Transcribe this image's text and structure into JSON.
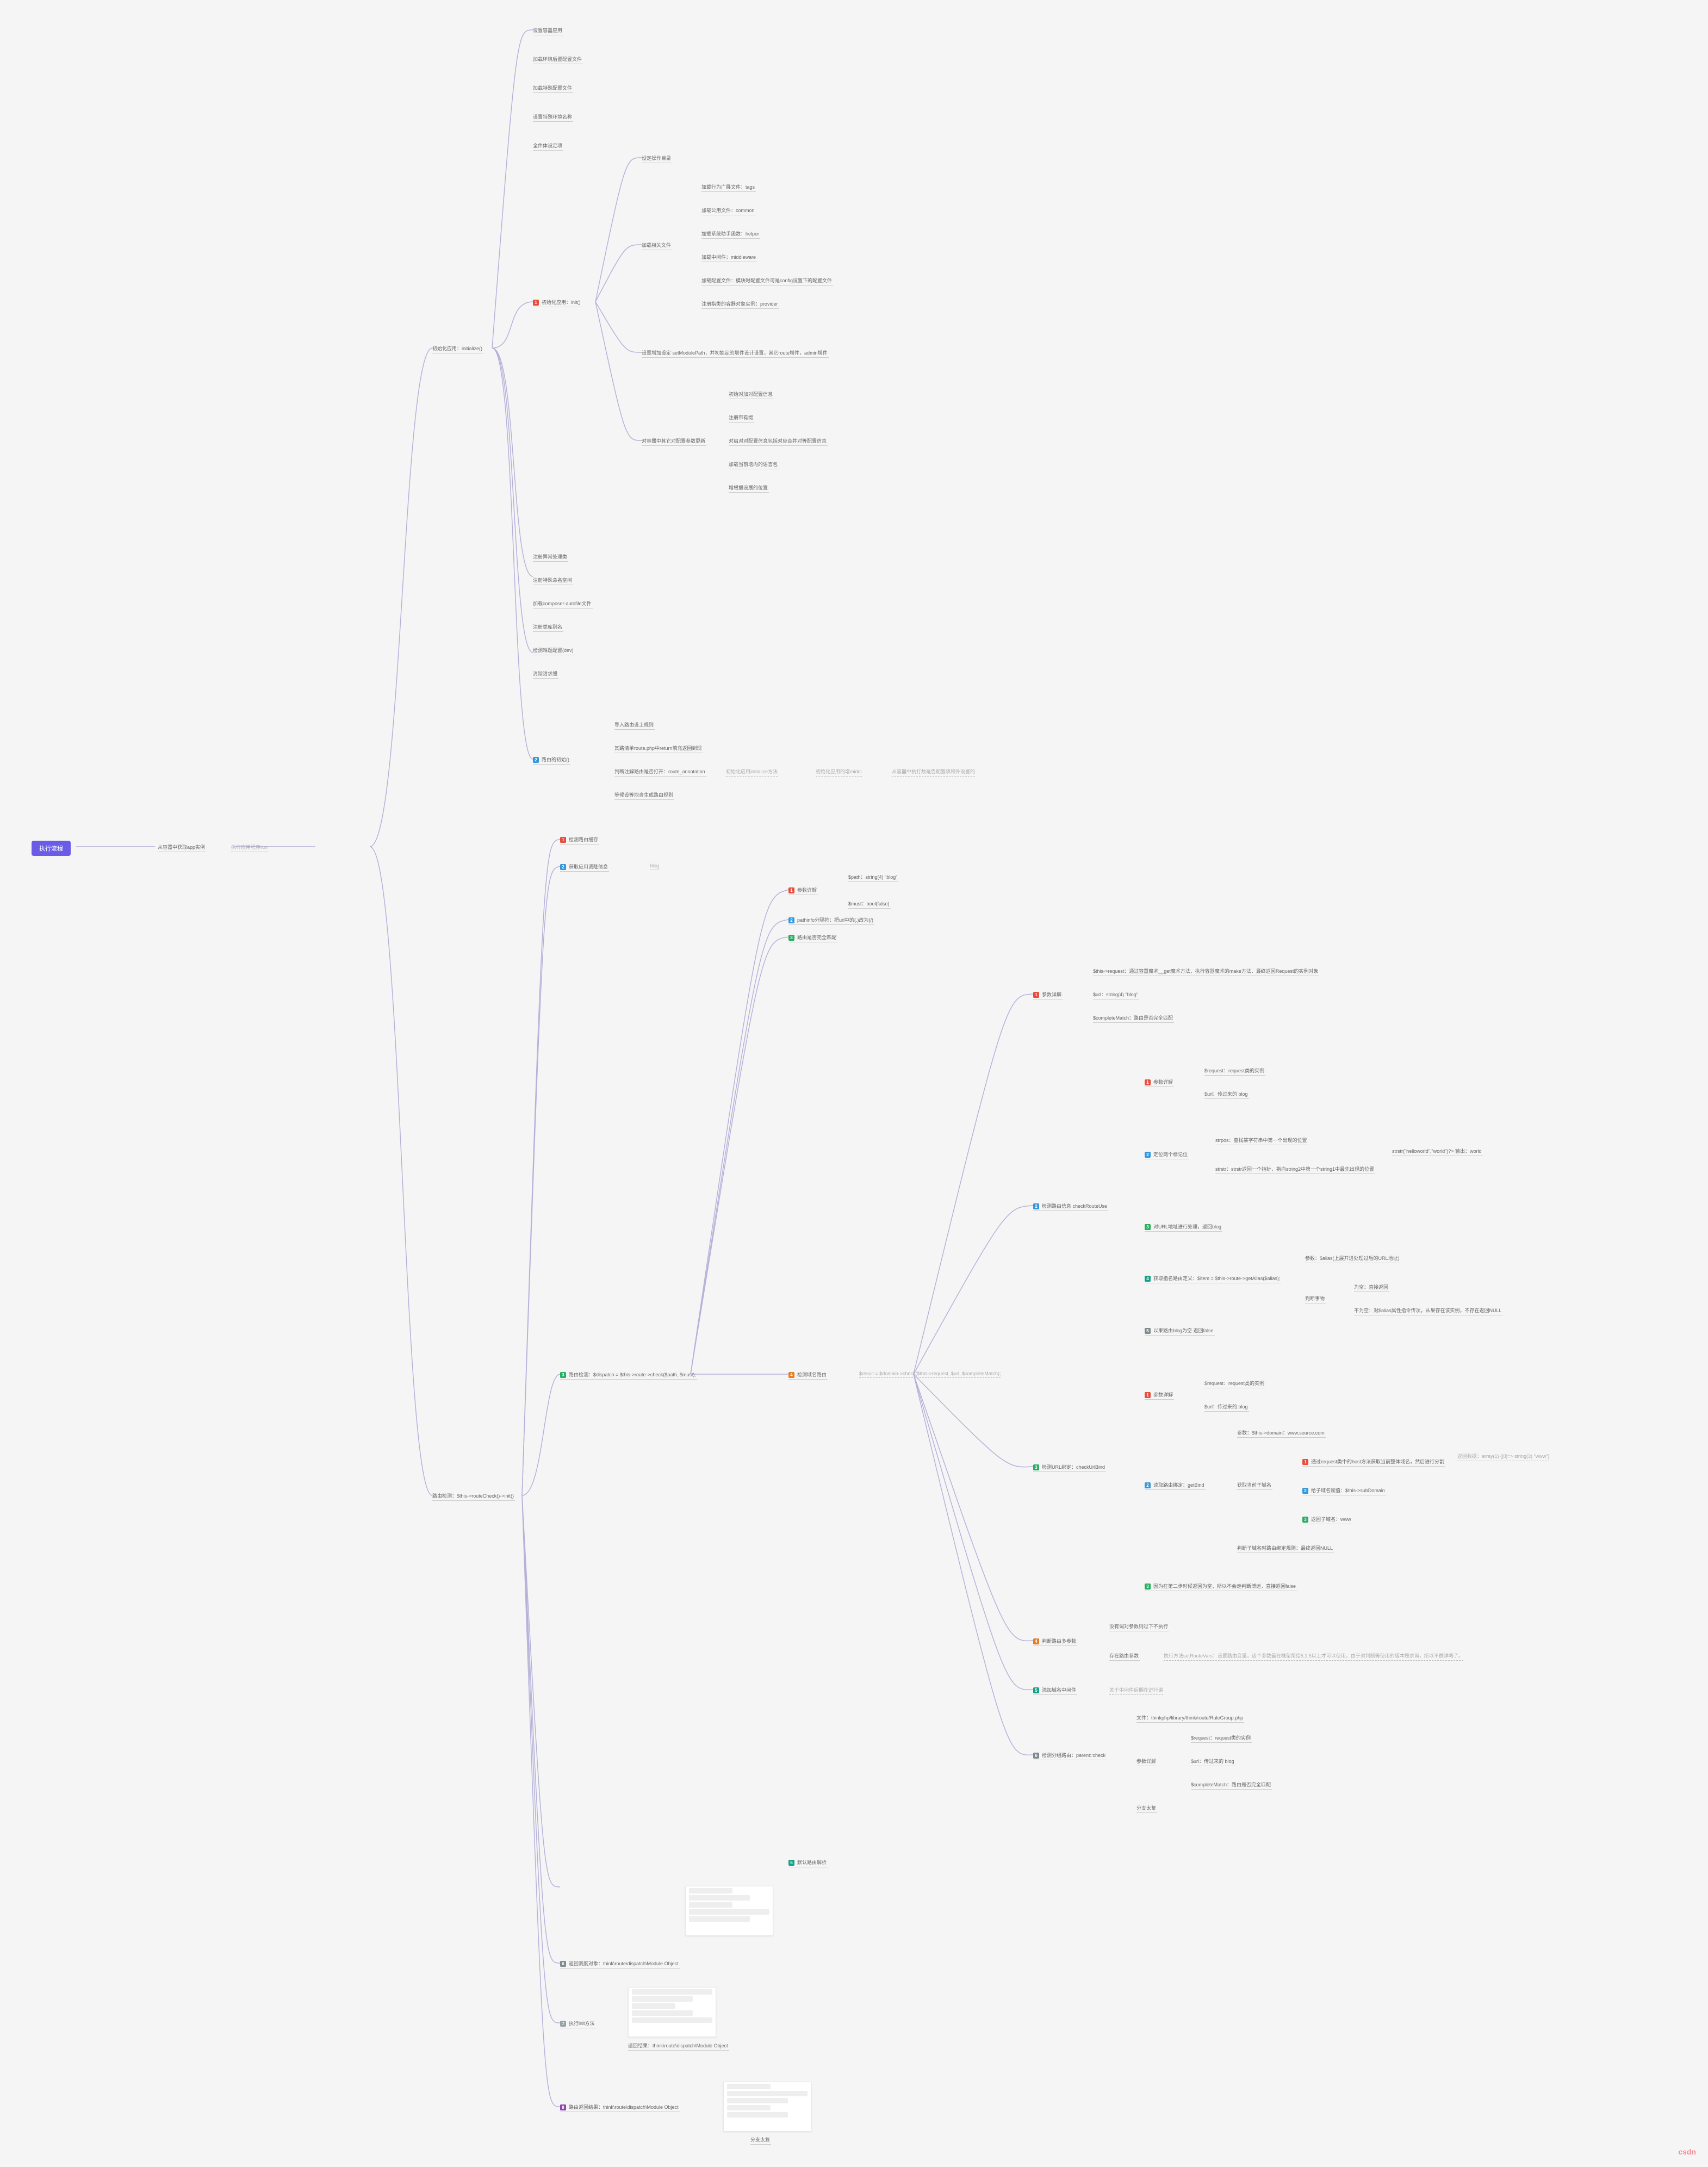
{
  "root": "执行流程",
  "n1": "从容器中获取app实例",
  "d1": "执行应用程序run",
  "n2": "初始化应用：initialize()",
  "c1": [
    "初始化应用：init()",
    "设置容器应用",
    "加载环境后置配置文件",
    "加载特殊配置文件",
    "设置特殊环境名称",
    "全件体设定项"
  ],
  "n3": "设定操作目录",
  "n4": "加载相关文件",
  "c4": [
    "加载行为广展文件：tags",
    "加载公用文件：common",
    "加载系统助手函数：helper",
    "加载中间件：middleware",
    "加载配置文件：模块时配置文件可是config设置下的配置文件",
    "注册指类的容器对象实例：provider"
  ],
  "n5": "设置增加设定 setModulePath，并初始定的增件设计设置，其它route增件，admin增件",
  "n6": "对容器中其它对配置参数更新",
  "c6": [
    "初始对加对配置信息",
    "注册带有缀",
    "对启对对配置信息包括对应合并对等配置信息",
    "加载当前增内的语言包",
    "增根据设展的位置"
  ],
  "c7": [
    "注册异常处理类",
    "注册特殊命名空间",
    "加载composer-autofile文件",
    "注册类库别名",
    "检测难题配置(dev)",
    "清除请求缓"
  ],
  "n8": "路由的初始()",
  "c8": [
    "导入路由设上规则",
    "其路清单route.php中return填充返回到现",
    "判断注解路由是否打开：route_annotation",
    "等候设等均含生成路由规则"
  ],
  "d2": "初始化应用initialize方法",
  "d3": "初始化应用的增middl",
  "d4": "从容器中执打数是告配置项和外设置的",
  "n10": "路由检测：$this->routeCheck()->init()",
  "c10a": [
    "检测路由缓存",
    "1",
    "c-red"
  ],
  "c10b": [
    "获取应用调隆信息",
    "2",
    "c-blue"
  ],
  "d10b": "blog",
  "c10c": [
    "路由检测：$dispatch = $this->route->check($path, $must);",
    "3",
    "c-green"
  ],
  "c10ca": [
    "参数详解",
    "1",
    "c-red"
  ],
  "c10ca1": "$path：string(4) \"blog\"",
  "c10ca2": "$must：bool(false)",
  "c10cb": [
    "pathinfo分隔符：把url中的(.)改为(/)",
    "2",
    "c-blue"
  ],
  "c10cc": [
    "路由是否完全匹配",
    "3",
    "c-green"
  ],
  "c10cd": [
    "检测域名路由",
    "4",
    "c-orange"
  ],
  "d10cd": "$result = $domain->check($this->request, $url, $completeMatch);",
  "c11a": [
    "参数详解",
    "1",
    "c-red"
  ],
  "c11a1": "$this->request：通过容器魔术__get魔术方法，执行容器魔术的make方法，最终返回Request的实例对象",
  "c11a2": "$url：string(4) \"blog\"",
  "c11a3": "$completeMatch：路由是否完全匹配",
  "c12": [
    "检测路由信息 checkRouteUse",
    "2",
    "c-blue"
  ],
  "c12a": [
    "参数详解",
    "1",
    "c-red"
  ],
  "c12a1": "$request：request类的实例",
  "c12a2": "$url：传过来的 blog",
  "c12b": [
    "定位两个标记位",
    "2",
    "c-blue"
  ],
  "c12b1": "strpos：查找某字符串中第一个出现的位置",
  "c12b2": "strstr：strstr返回一个指针，指向string2中第一个string1中最先出现的位置",
  "c12b3": "strstr(\"helloworld\",\"world\")?>  输出：world",
  "c12c": [
    "对URL地址进行处理，返回blog",
    "3",
    "c-green"
  ],
  "c12d": [
    "获取指名路由定义：$item = $this->route->getAlias($alias);",
    "4",
    "c-emerald"
  ],
  "c12d1": "参数：$alias(上展开进处理过后的URL地址)",
  "c12d2": "判断事物",
  "c12d2a": "为空：直接返回",
  "c12d2b": "不为空：对$alias属性指令传次，从果存在该实例，不存在返回NULL",
  "c12e": [
    "以果路由blog为空 返回false",
    "5",
    "c-gray"
  ],
  "c13": [
    "检测URL绑定：checkUrlBind",
    "3",
    "c-green"
  ],
  "c13a": [
    "参数详解",
    "1",
    "c-red"
  ],
  "c13a1": "$request：request类的实例",
  "c13a2": "$url：传过来的 blog",
  "c13b": [
    "读取路由绑定：getBind",
    "2",
    "c-blue"
  ],
  "c13b1": "参数：$this->domain：www.source.com",
  "c13b2": "获取当前子域名",
  "c13b2a": [
    "通过request类中的host方法获取当前整体域名，然后进行分割",
    "1",
    "c-red"
  ],
  "c13b2aR": "返回数据：array(1) {[0]=> string(3) \"www\"}",
  "c13b2b": [
    "给子域名赋值：$this->subDomain",
    "2",
    "c-blue"
  ],
  "c13b2c": [
    "返回子域名：www",
    "3",
    "c-green"
  ],
  "c13b3": "判断子域名时路由绑定规则：最终返回NULL",
  "c13c": [
    "因为在第二步时候返回为空，所以不会走判断博运，直接返回false",
    "3",
    "c-green"
  ],
  "c14": [
    "判断路由多参数",
    "4",
    "c-orange"
  ],
  "c14a": "没有词对参数则过下不执行",
  "c14b": "存在路由参数",
  "c14bd": "执行方法setRouteVars：设置路由变量，这个参数最在框架帮给5.1.5以上才可以使用，由于对判断等使用的版本是求尚，所以不做详略了。",
  "c15": [
    "添加域名中间件",
    "5",
    "c-emerald"
  ],
  "c15d": "关于中间件后期在进行讲",
  "c16": [
    "检测分组路由：parent::check",
    "6",
    "c-gray"
  ],
  "c16a": "文件：thinkphp/library/think/route/RuleGroup.php",
  "c16b": "参数详解",
  "c16b1": "$request：request类的实例",
  "c16b2": "$url：传过来的 blog",
  "c16b3": "$completeMatch：路由是否完全匹配",
  "c16c": "分支太复",
  "c10d": [
    "默认路由解析",
    "5",
    "c-emerald"
  ],
  "c10e": [
    "返回调度对象：think\\route\\dispatch\\Module Object",
    "6",
    "c-gray"
  ],
  "c10f": [
    "执行init方法",
    "7",
    "c-slate"
  ],
  "c10f1": "返回结果：think\\route\\dispatch\\Module Object",
  "c10g": [
    "路由返回结果：think\\route\\dispatch\\Module Object",
    "8",
    "c-purple"
  ],
  "c10g1": "分支太复",
  "watermark": "csdn"
}
